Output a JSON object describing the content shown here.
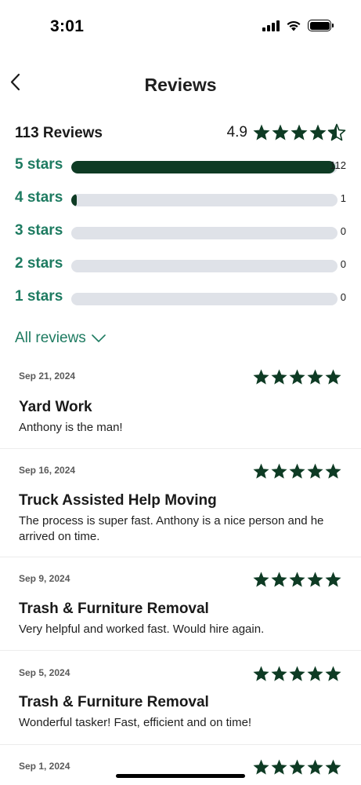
{
  "status_bar": {
    "time": "3:01"
  },
  "header": {
    "title": "Reviews"
  },
  "summary": {
    "count_label": "113 Reviews",
    "rating": "4.9",
    "rating_value": 4.9
  },
  "distribution": [
    {
      "label": "5 stars",
      "count": "112",
      "fraction": 0.991
    },
    {
      "label": "4 stars",
      "count": "1",
      "fraction": 0.009
    },
    {
      "label": "3 stars",
      "count": "0",
      "fraction": 0
    },
    {
      "label": "2 stars",
      "count": "0",
      "fraction": 0
    },
    {
      "label": "1 stars",
      "count": "0",
      "fraction": 0
    }
  ],
  "filter": {
    "label": "All reviews"
  },
  "reviews": [
    {
      "date": "Sep 21, 2024",
      "title": "Yard Work",
      "body": "Anthony is the man!",
      "stars": 5
    },
    {
      "date": "Sep 16, 2024",
      "title": "Truck Assisted Help Moving",
      "body": "The process is super fast. Anthony is a nice person and he arrived on time.",
      "stars": 5
    },
    {
      "date": "Sep 9, 2024",
      "title": "Trash & Furniture Removal",
      "body": "Very helpful and worked fast. Would hire again.",
      "stars": 5
    },
    {
      "date": "Sep 5, 2024",
      "title": "Trash & Furniture Removal",
      "body": "Wonderful tasker! Fast, efficient and on time!",
      "stars": 5
    },
    {
      "date": "Sep 1, 2024",
      "title": "",
      "body": "",
      "stars": 5
    }
  ],
  "colors": {
    "accent_green": "#1e7b61",
    "star_dark": "#0e3b24",
    "track": "#dfe2e8"
  },
  "icons": [
    "back-chevron-icon",
    "star-icon",
    "half-star-icon",
    "chevron-down-icon",
    "signal-icon",
    "wifi-icon",
    "battery-icon"
  ]
}
